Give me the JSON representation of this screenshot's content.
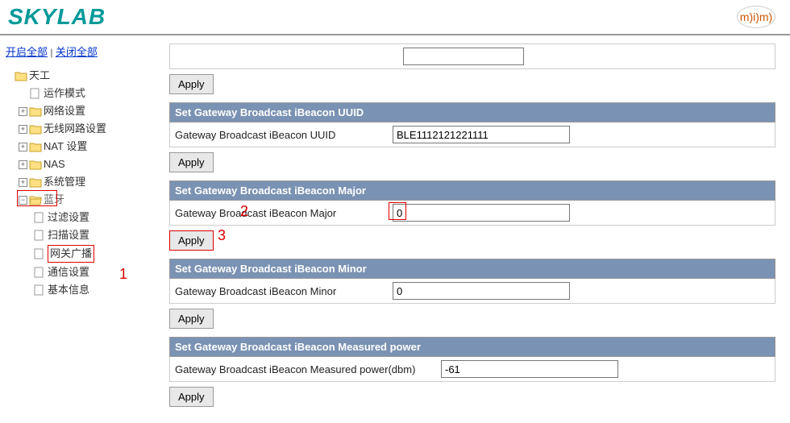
{
  "header": {
    "brand": "SKYLAB",
    "right_logo": "m)i)m)"
  },
  "sidebar": {
    "open_all": "开启全部",
    "close_all": "关闭全部",
    "tree": {
      "root": "天工",
      "items": [
        {
          "label": "运作模式",
          "type": "file"
        },
        {
          "label": "网络设置",
          "type": "folder",
          "expandable": true
        },
        {
          "label": "无线网路设置",
          "type": "folder",
          "expandable": true
        },
        {
          "label": "NAT 设置",
          "type": "folder",
          "expandable": true
        },
        {
          "label": "NAS",
          "type": "folder",
          "expandable": true
        },
        {
          "label": "系统管理",
          "type": "folder",
          "expandable": true
        },
        {
          "label": "蓝牙",
          "type": "folder",
          "expandable": true,
          "expanded": true,
          "children": [
            {
              "label": "过滤设置"
            },
            {
              "label": "扫描设置"
            },
            {
              "label": "网关广播",
              "highlighted": true
            },
            {
              "label": "通信设置"
            },
            {
              "label": "基本信息"
            }
          ]
        }
      ]
    }
  },
  "annotations": {
    "a1": "1",
    "a2": "2",
    "a3": "3"
  },
  "content": {
    "apply": "Apply",
    "sec_uuid": {
      "header": "Set Gateway Broadcast iBeacon UUID",
      "label": "Gateway Broadcast iBeacon UUID",
      "value": "BLE1112121221111"
    },
    "sec_major": {
      "header": "Set Gateway Broadcast iBeacon Major",
      "label": "Gateway Broadcast iBeacon Major",
      "value": "0"
    },
    "sec_minor": {
      "header": "Set Gateway Broadcast iBeacon Minor",
      "label": "Gateway Broadcast iBeacon Minor",
      "value": "0"
    },
    "sec_power": {
      "header": "Set Gateway Broadcast iBeacon Measured power",
      "label": "Gateway Broadcast iBeacon Measured power(dbm)",
      "value": "-61"
    }
  }
}
